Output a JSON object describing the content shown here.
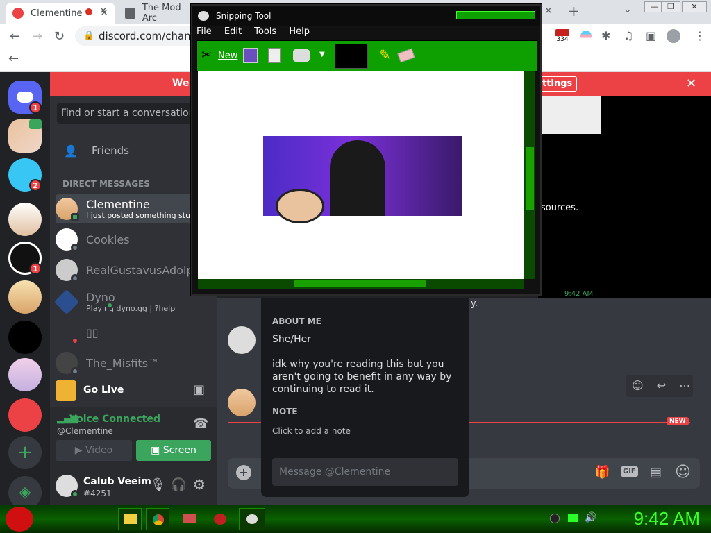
{
  "browser": {
    "tabs": [
      {
        "title": "Clementine",
        "color": "#ed4245"
      },
      {
        "title": "The Mod Arc",
        "color": "#5f6368"
      }
    ],
    "url": "discord.com/channels",
    "ext_badge": "334",
    "new_tab": "+"
  },
  "discord": {
    "banner_text": "Wel",
    "banner_btn": "ttings",
    "search_placeholder": "Find or start a conversation",
    "friends_label": "Friends",
    "dm_header": "DIRECT MESSAGES",
    "guild_badges": [
      "1",
      "2",
      "1"
    ],
    "dms": [
      {
        "name": "Clementine",
        "sub": "I just posted something stup",
        "active": true
      },
      {
        "name": "Cookies",
        "sub": ""
      },
      {
        "name": "RealGustavusAdolph",
        "sub": ""
      },
      {
        "name": "Dyno",
        "sub": "Playing dyno.gg | ?help"
      },
      {
        "name": "▯▯",
        "sub": ""
      },
      {
        "name": "The_Misfits™",
        "sub": ""
      }
    ],
    "go_live": "Go Live",
    "voice_connected": "Voice Connected",
    "voice_channel": "@Clementine",
    "video_btn": "Video",
    "screen_btn": "Screen",
    "username": "Calub Veeim",
    "discriminator": "#4251",
    "behind_text": "sources.",
    "behind_time": "9:42 AM",
    "msg_tail": "y.",
    "new_label": "NEW"
  },
  "profile": {
    "about_header": "ABOUT ME",
    "pronouns": "She/Her",
    "about_text": "idk why you're reading this but you aren't going to benefit in any way by continuing to read it.",
    "note_header": "NOTE",
    "note_placeholder": "Click to add a note",
    "message_placeholder": "Message @Clementine"
  },
  "snipping": {
    "title": "Snipping Tool",
    "menu": [
      "File",
      "Edit",
      "Tools",
      "Help"
    ],
    "new_label": "New"
  },
  "taskbar": {
    "clock": "9:42 AM"
  },
  "colors": {
    "accent_green": "#3ba55d",
    "red": "#ed4245",
    "blurple": "#5865f2",
    "theme_green": "#0ea000"
  }
}
